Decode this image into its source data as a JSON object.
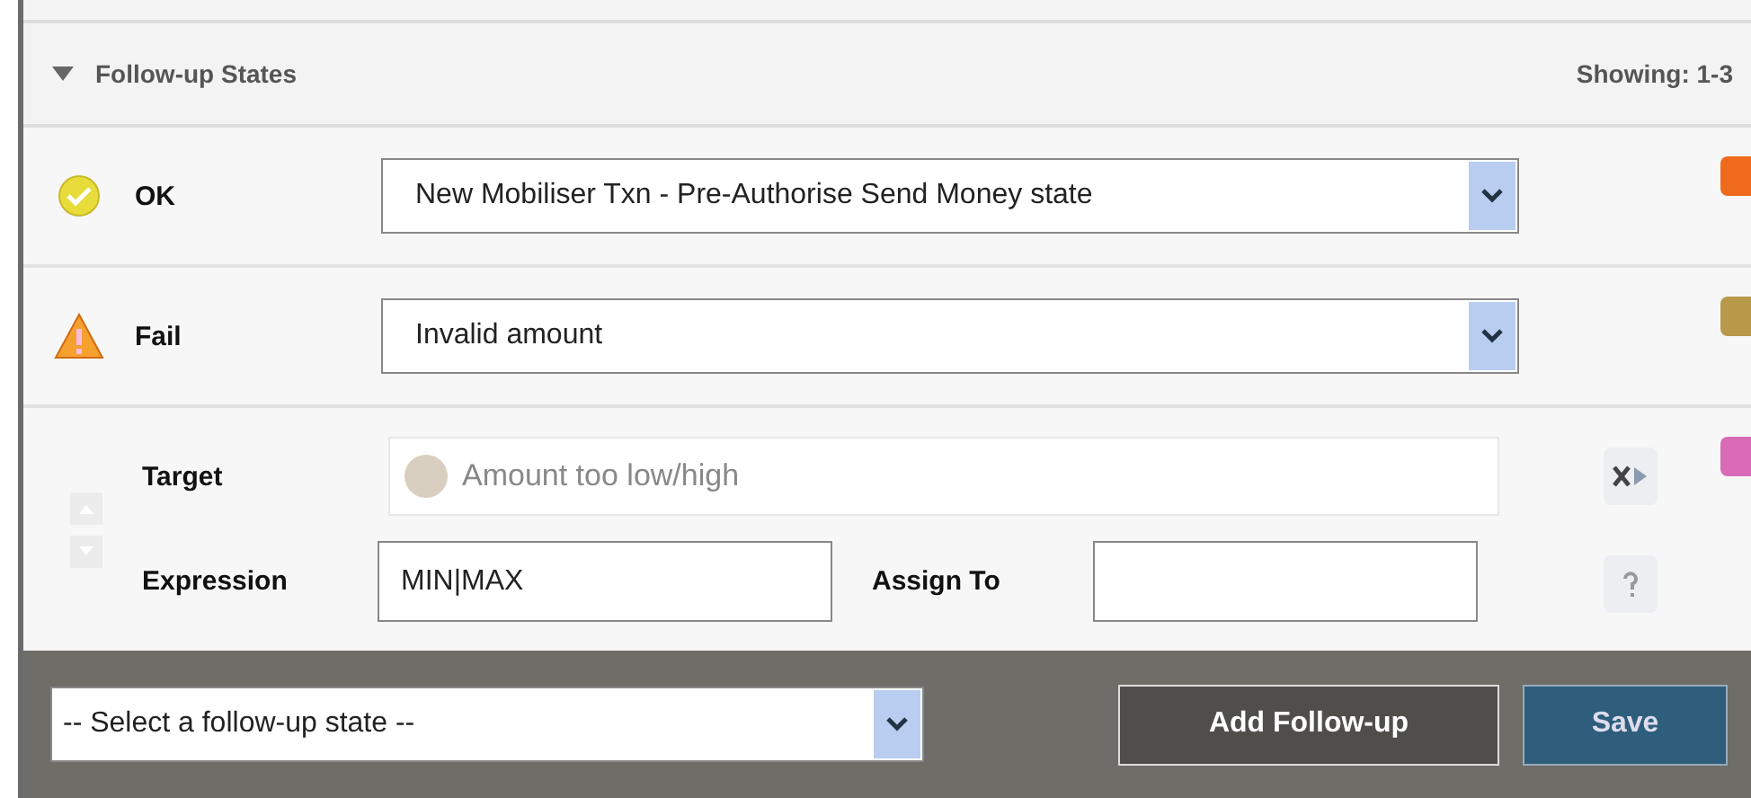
{
  "section": {
    "title": "Follow-up States",
    "expanded": true,
    "showing": "Showing: 1-3"
  },
  "states": [
    {
      "kind": "ok",
      "label": "OK",
      "value": "New Mobiliser Txn - Pre-Authorise Send Money state",
      "color": "#f06a1e"
    },
    {
      "kind": "fail",
      "label": "Fail",
      "value": "Invalid amount",
      "color": "#b8994a"
    },
    {
      "kind": "mapping",
      "target_label": "Target",
      "target_value": "Amount too low/high",
      "expression_label": "Expression",
      "expression_value": "MIN|MAX",
      "assign_label": "Assign To",
      "color": "#d96bb6"
    }
  ],
  "footer": {
    "select_placeholder": "-- Select a follow-up state --",
    "add_button": "Add Follow-up",
    "save_button": "Save"
  }
}
